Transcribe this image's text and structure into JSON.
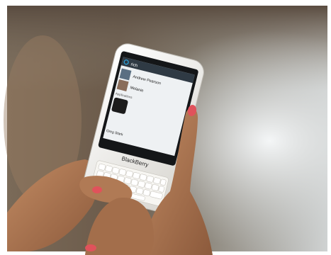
{
  "photo": {
    "phone_brand": "BlackBerry",
    "search_query": "rich",
    "contacts": [
      {
        "name": "Andrew Pearson"
      },
      {
        "name": "Melanie"
      }
    ],
    "section_label": "Applications",
    "recent_name": "Greg Stark",
    "colors": {
      "phone_body": "#f3f2ee",
      "screen_dark": "#141618",
      "skin": "#b07a55",
      "nail": "#e0525b",
      "accent": "#2aa6e0"
    }
  }
}
